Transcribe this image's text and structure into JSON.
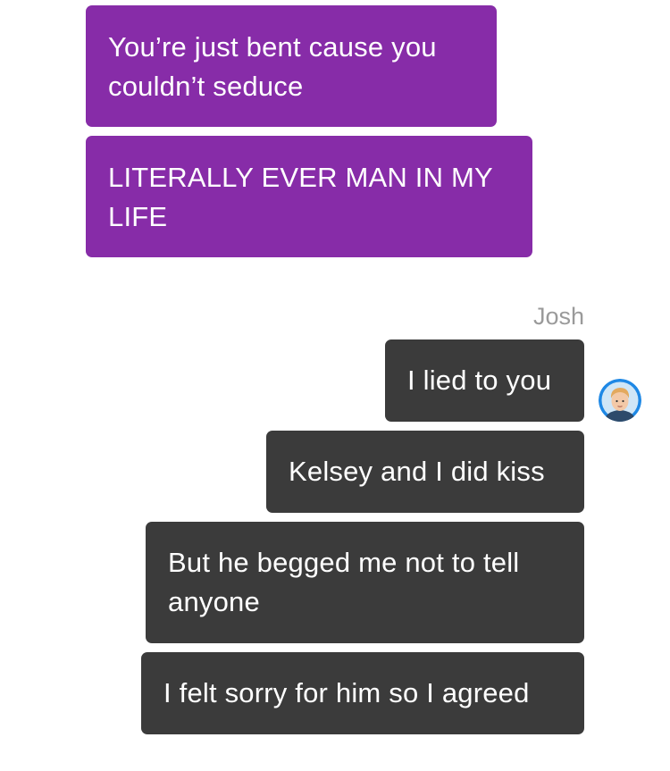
{
  "conversation": {
    "incoming": [
      {
        "text": "You’re just bent cause you couldn’t seduce"
      },
      {
        "text": "LITERALLY EVER MAN IN MY LIFE"
      }
    ],
    "sender": {
      "name": "Josh",
      "avatar": "person-avatar-icon"
    },
    "outgoing": [
      {
        "text": "I lied to you"
      },
      {
        "text": "Kelsey and I did kiss"
      },
      {
        "text": "But he begged me not to tell anyone"
      },
      {
        "text": "I felt sorry for him so I agreed"
      }
    ]
  },
  "colors": {
    "purple_bubble": "#872ca8",
    "dark_bubble": "#3b3b3b",
    "sender_name": "#9a9a9a",
    "avatar_ring": "#1e88e5"
  }
}
